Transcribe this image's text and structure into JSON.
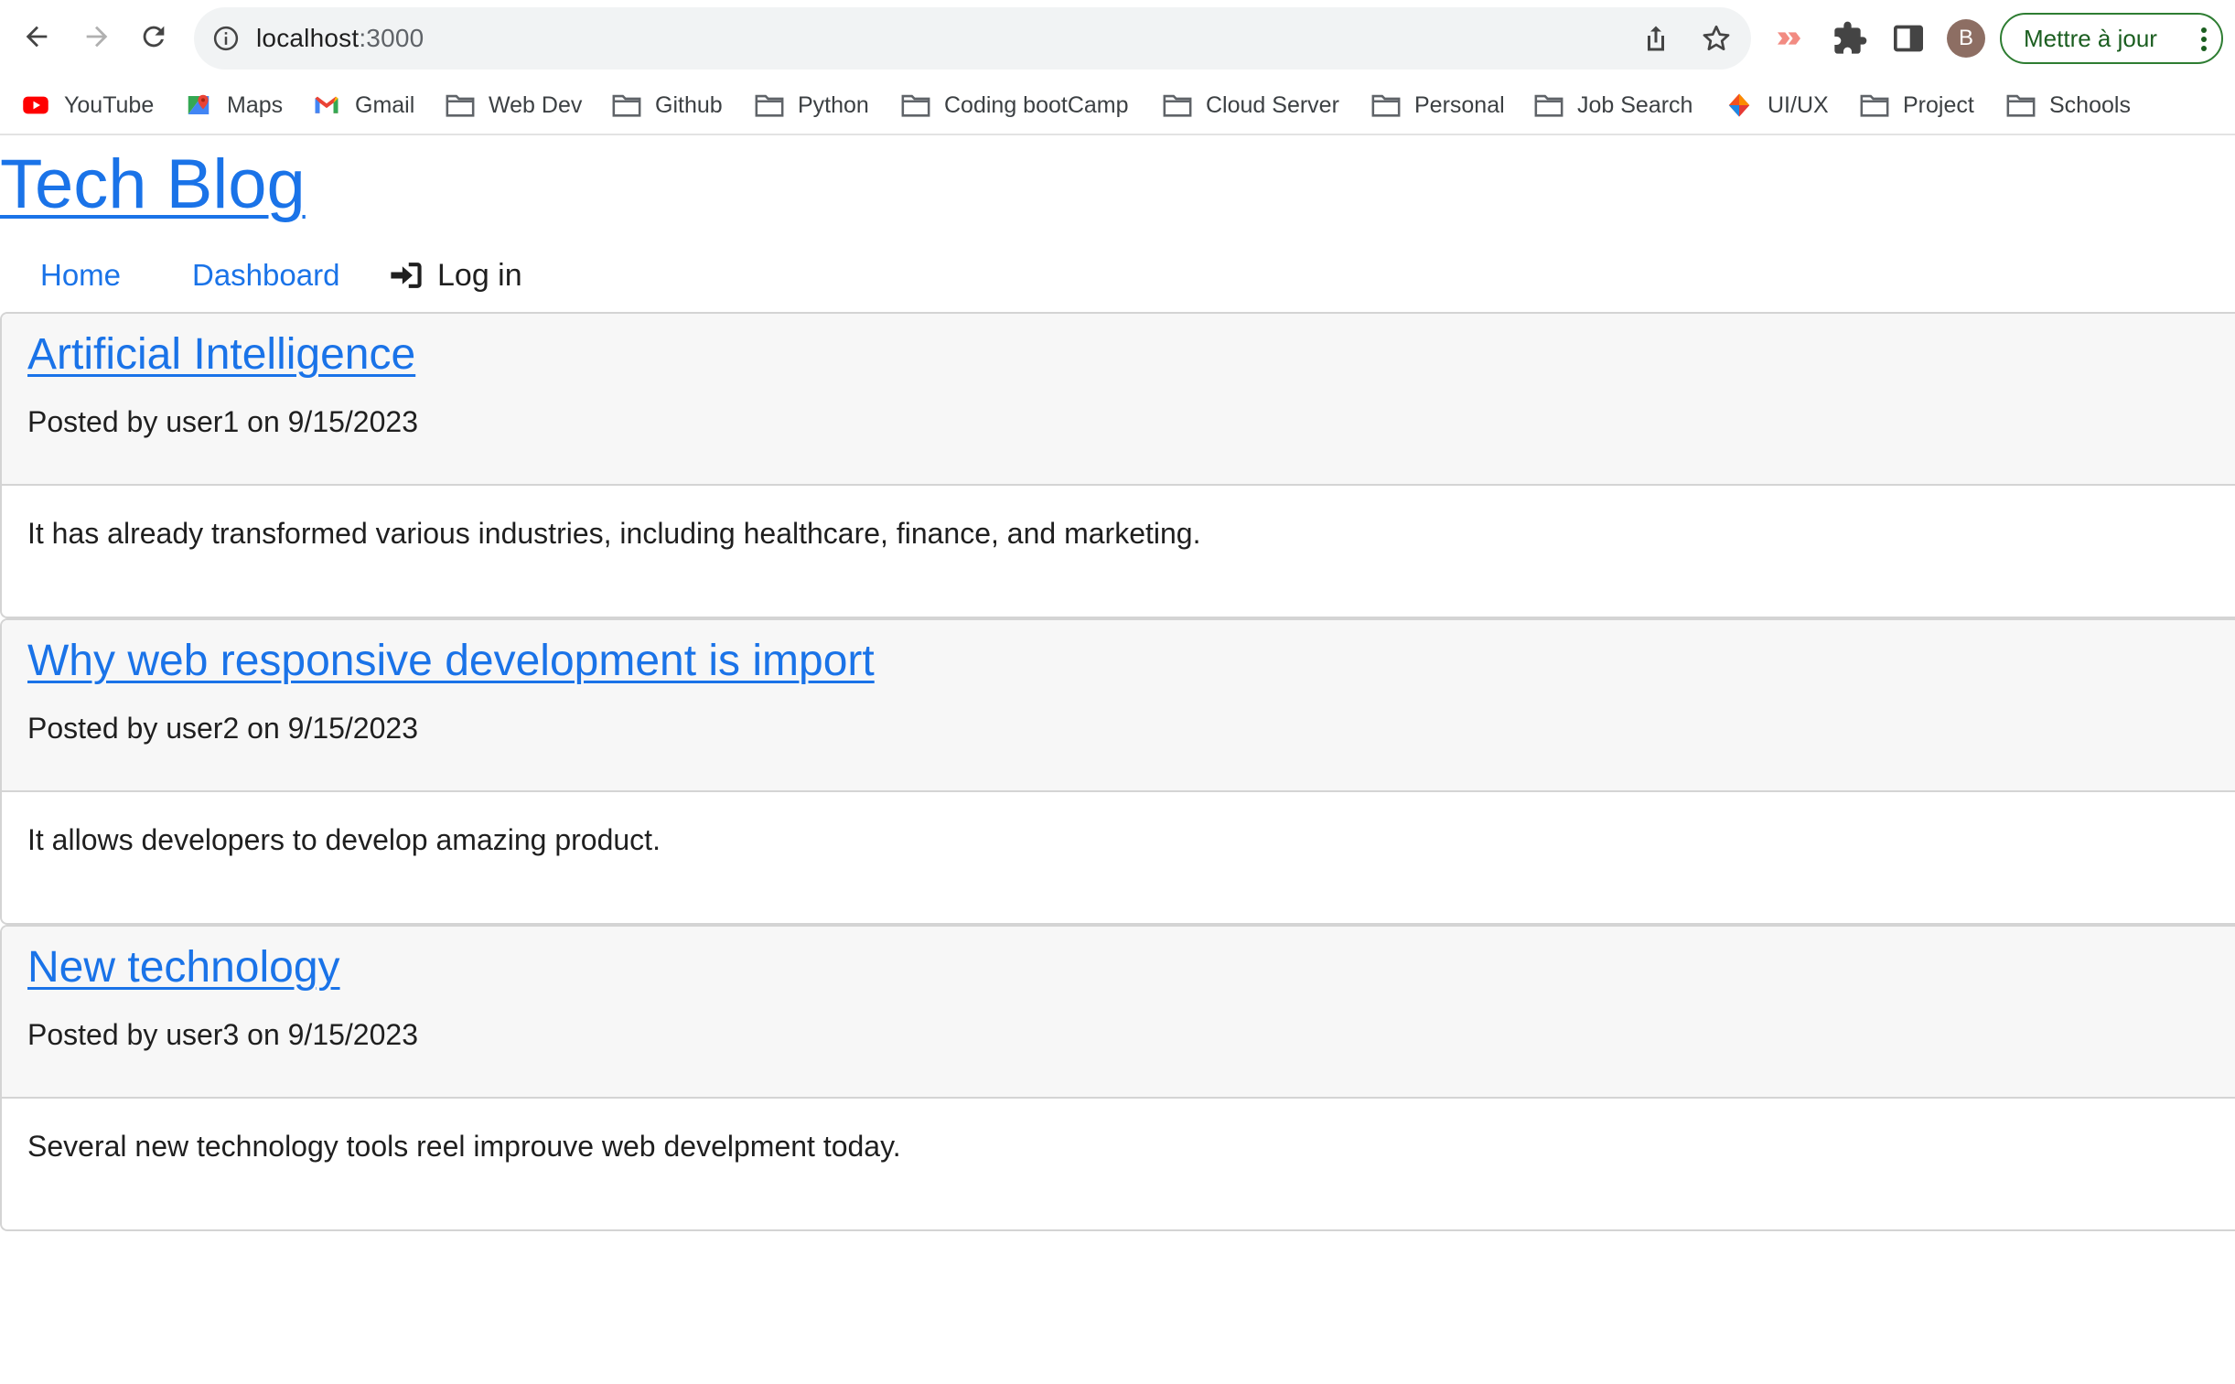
{
  "browser": {
    "url_host": "localhost",
    "url_port": ":3000",
    "profile_initial": "B",
    "update_button_label": "Mettre à jour",
    "bookmarks": [
      {
        "label": "YouTube",
        "icon": "youtube-icon"
      },
      {
        "label": "Maps",
        "icon": "maps-icon"
      },
      {
        "label": "Gmail",
        "icon": "gmail-icon"
      },
      {
        "label": "Web Dev",
        "icon": "folder-icon"
      },
      {
        "label": "Github",
        "icon": "folder-icon"
      },
      {
        "label": "Python",
        "icon": "folder-icon"
      },
      {
        "label": "Coding bootCamp",
        "icon": "folder-icon"
      },
      {
        "label": "Cloud Server",
        "icon": "folder-icon"
      },
      {
        "label": "Personal",
        "icon": "folder-icon"
      },
      {
        "label": "Job Search",
        "icon": "folder-icon"
      },
      {
        "label": "UI/UX",
        "icon": "figma-icon"
      },
      {
        "label": "Project",
        "icon": "folder-icon"
      },
      {
        "label": "Schools",
        "icon": "folder-icon"
      }
    ]
  },
  "site": {
    "title": "Tech Blog",
    "nav": {
      "home": "Home",
      "dashboard": "Dashboard",
      "login": "Log in"
    }
  },
  "posts": [
    {
      "title": "Artificial Intelligence",
      "meta": "Posted by user1 on 9/15/2023",
      "body": "It has already transformed various industries, including healthcare, finance, and marketing."
    },
    {
      "title": "Why web responsive development is import",
      "meta": "Posted by user2 on 9/15/2023",
      "body": "It allows developers to develop amazing product."
    },
    {
      "title": "New technology",
      "meta": "Posted by user3 on 9/15/2023",
      "body": "Several new technology tools reel improuve web develpment today."
    }
  ],
  "colors": {
    "link": "#1a73e8",
    "update_button": "#2e7d32",
    "card_header_bg": "#f7f7f7",
    "card_border": "#d4d4d4"
  }
}
